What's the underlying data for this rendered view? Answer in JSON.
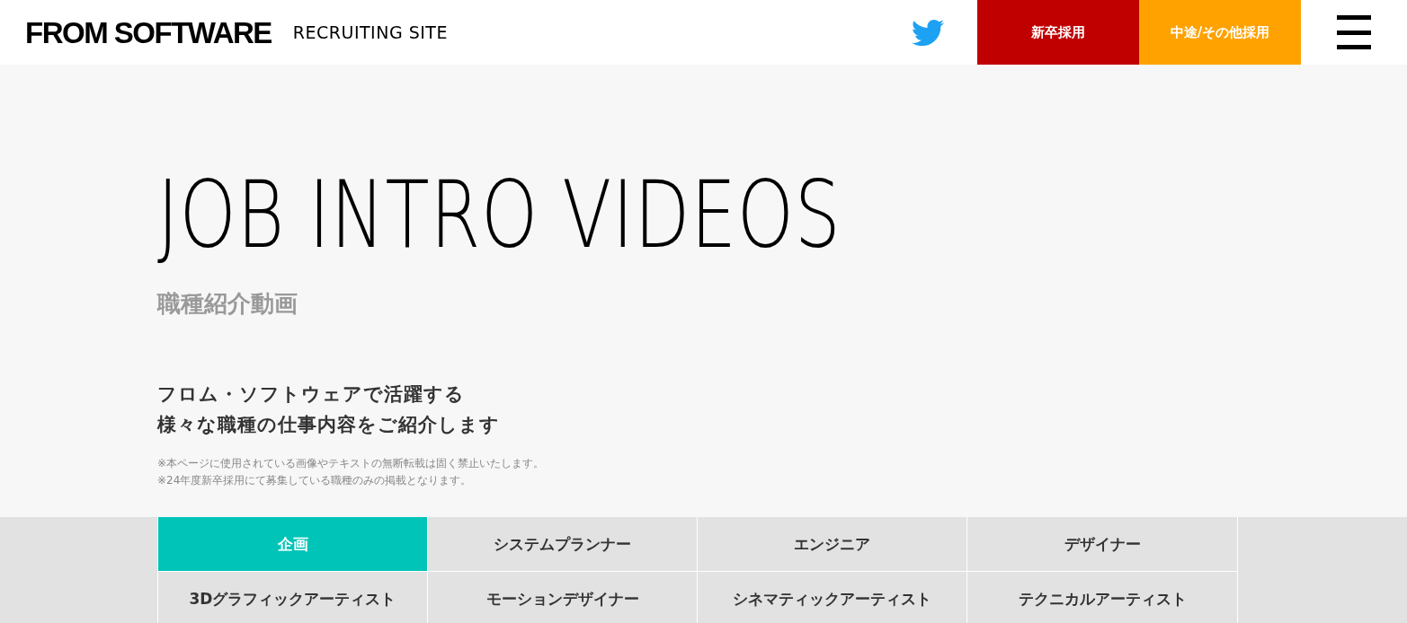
{
  "header": {
    "logo": "FROM SOFTWARE",
    "site_label": "RECRUITING SITE",
    "nav_buttons": [
      {
        "label": "新卒採用",
        "color": "#c00000"
      },
      {
        "label": "中途/その他採用",
        "color": "#ffa200"
      }
    ]
  },
  "hero": {
    "title": "JOB INTRO VIDEOS",
    "subtitle": "職種紹介動画",
    "lead": [
      "フロム・ソフトウェアで活躍する",
      "様々な職種の仕事内容をご紹介します"
    ],
    "notes": [
      "※本ページに使用されている画像やテキストの無断転載は固く禁止いたします。",
      "※24年度新卒採用にて募集している職種のみの掲載となります。"
    ]
  },
  "job_tabs": [
    {
      "label": "企画",
      "selected": true
    },
    {
      "label": "システムプランナー",
      "selected": false
    },
    {
      "label": "エンジニア",
      "selected": false
    },
    {
      "label": "デザイナー",
      "selected": false
    },
    {
      "label": "3Dグラフィックアーティスト",
      "selected": false
    },
    {
      "label": "モーションデザイナー",
      "selected": false
    },
    {
      "label": "シネマティックアーティスト",
      "selected": false
    },
    {
      "label": "テクニカルアーティスト",
      "selected": false
    }
  ]
}
